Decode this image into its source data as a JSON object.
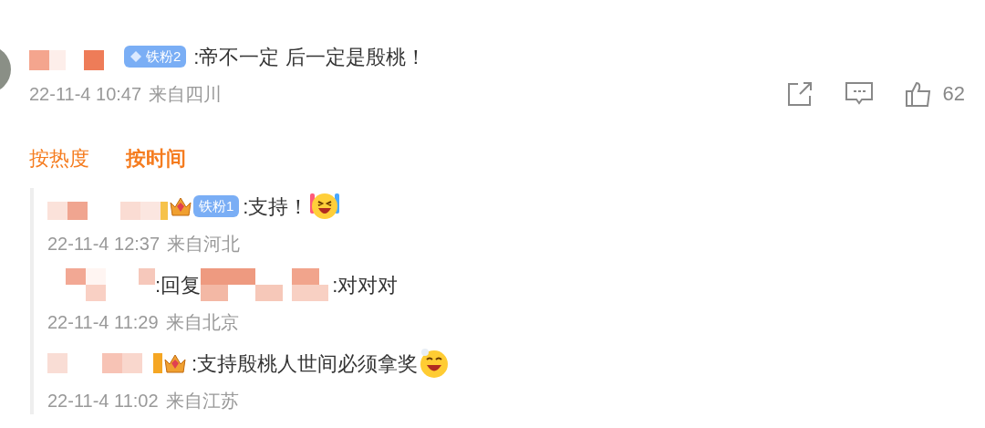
{
  "comment": {
    "badge": "铁粉2",
    "text": ":帝不一定 后一定是殷桃！",
    "time": "22-11-4 10:47",
    "location": "来自四川",
    "likes": "62"
  },
  "sort_tabs": [
    {
      "label": "按热度",
      "selected": false
    },
    {
      "label": "按时间",
      "selected": true
    }
  ],
  "replies": [
    {
      "kind": "comment",
      "badge": "铁粉1",
      "text": ":支持！",
      "time": "22-11-4 12:37",
      "location": "来自河北"
    },
    {
      "kind": "reply",
      "reply_label": ":回复",
      "text": ":对对对",
      "time": "22-11-4 11:29",
      "location": "来自北京"
    },
    {
      "kind": "comment",
      "text": ":支持殷桃人世间必须拿奖",
      "time": "22-11-4 11:02",
      "location": "来自江苏"
    }
  ]
}
